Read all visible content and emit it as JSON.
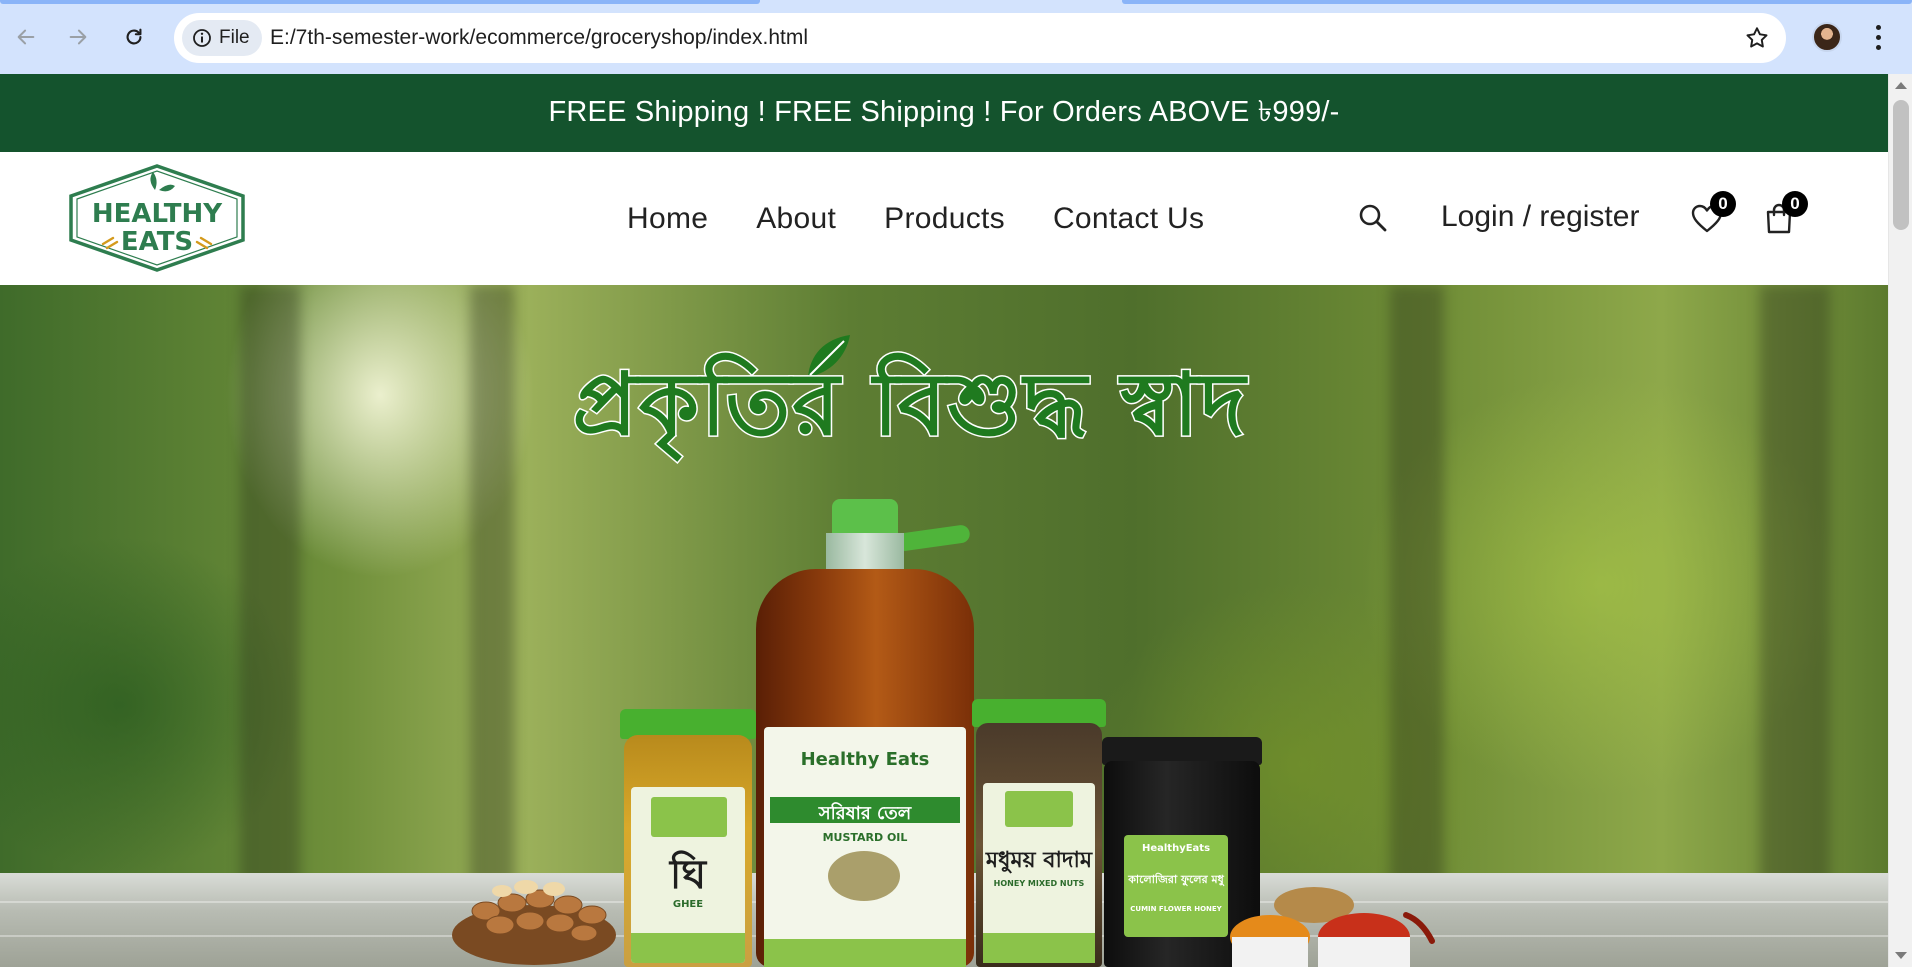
{
  "browser": {
    "site_chip_label": "File",
    "url": "E:/7th-semester-work/ecommerce/groceryshop/index.html"
  },
  "promo": {
    "text": "FREE Shipping ! FREE Shipping ! For Orders ABOVE ৳999/-"
  },
  "header": {
    "logo": {
      "line1": "HEALTHY",
      "line2": "EATS"
    },
    "nav": [
      "Home",
      "About",
      "Products",
      "Contact Us"
    ],
    "login_label": "Login / register",
    "wishlist_count": "0",
    "cart_count": "0"
  },
  "hero": {
    "headline": "প্রকৃতির বিশুদ্ধ স্বাদ",
    "products": {
      "ghee": {
        "name": "ঘি",
        "sub": "GHEE"
      },
      "oil": {
        "brand": "Healthy Eats",
        "name": "সরিষার তেল",
        "sub": "MUSTARD OIL"
      },
      "nuts": {
        "name": "মধুময় বাদাম",
        "sub": "HONEY MIXED NUTS"
      },
      "honey": {
        "brand": "HealthyEats",
        "name": "কালোজিরা ফুলের মধু",
        "sub": "CUMIN FLOWER HONEY"
      }
    }
  },
  "colors": {
    "promo_bg": "#14532d",
    "brand_green": "#1f7a1f",
    "badge_bg": "#000000"
  }
}
